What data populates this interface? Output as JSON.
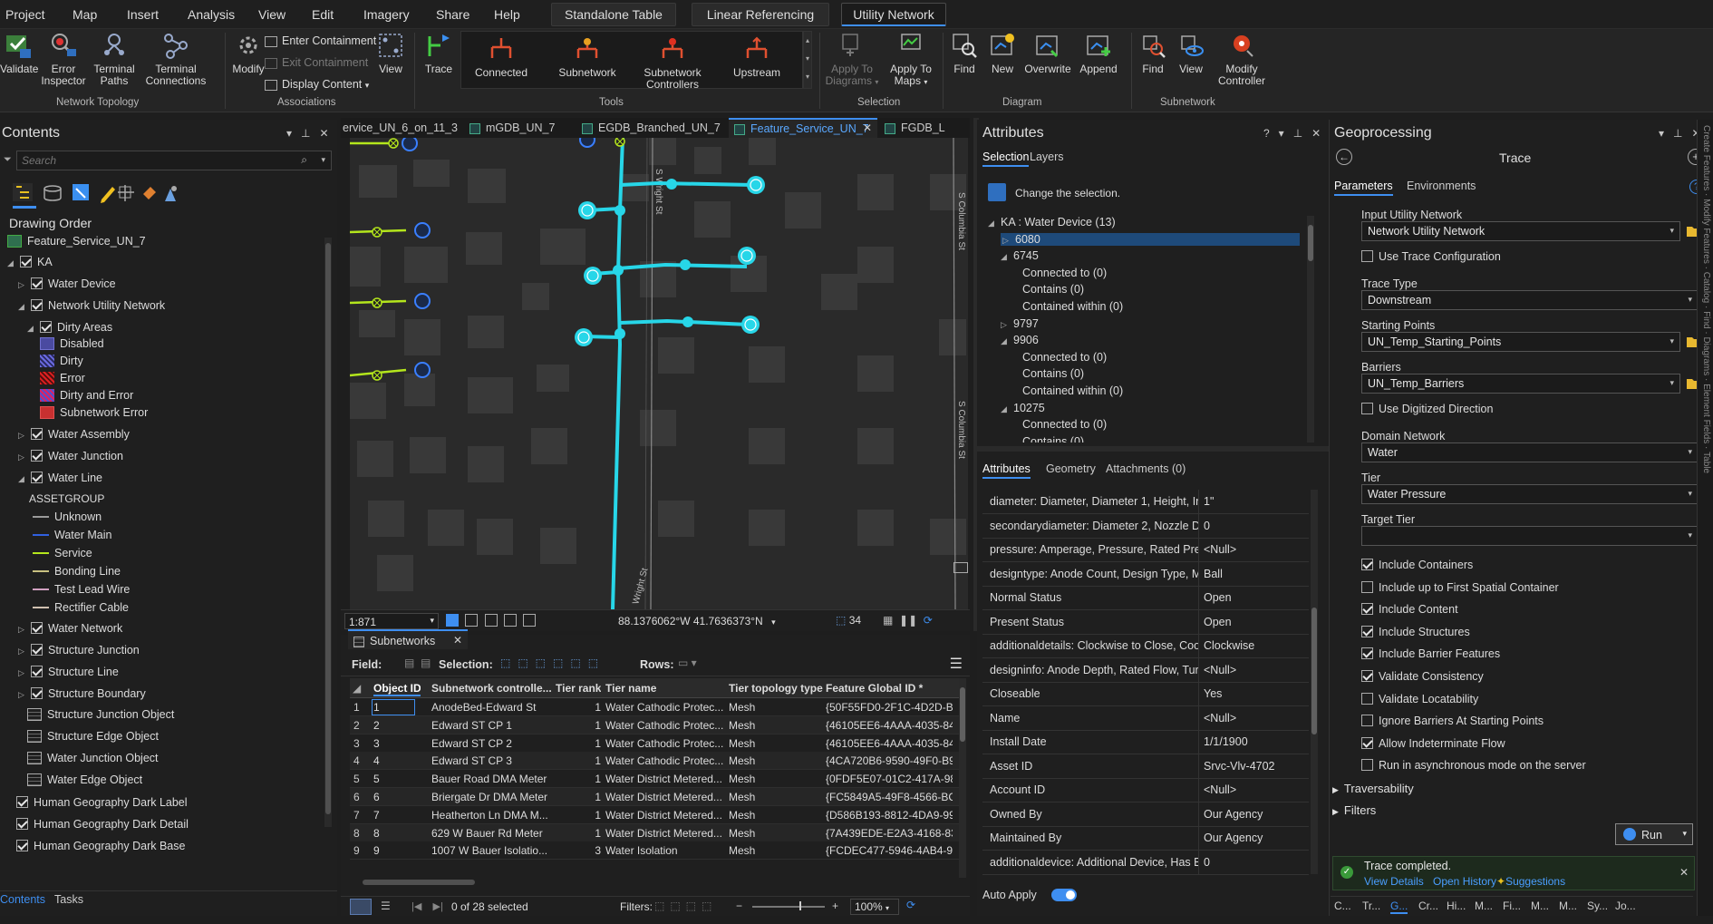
{
  "menubar": {
    "items": [
      "Project",
      "Map",
      "Insert",
      "Analysis",
      "View",
      "Edit",
      "Imagery",
      "Share",
      "Help"
    ],
    "context_tabs": [
      "Standalone Table",
      "Linear Referencing",
      "Utility Network"
    ]
  },
  "ribbon": {
    "network_topology": {
      "label": "Network Topology",
      "validate": "Validate",
      "error_inspector": "Error Inspector",
      "terminal_paths": "Terminal Paths",
      "terminal_connections": "Terminal Connections"
    },
    "associations": {
      "label": "Associations",
      "modify": "Modify",
      "enter_containment": "Enter Containment",
      "exit_containment": "Exit Containment",
      "display_content": "Display Content",
      "view": "View"
    },
    "tools": {
      "label": "Tools",
      "trace": "Trace",
      "connected": "Connected",
      "subnetwork": "Subnetwork",
      "subnetwork_controllers": "Subnetwork Controllers",
      "upstream": "Upstream"
    },
    "selection": {
      "label": "Selection",
      "apply_to_diagrams": "Apply To Diagrams",
      "apply_to_maps": "Apply To Maps"
    },
    "diagram": {
      "label": "Diagram",
      "find": "Find",
      "new": "New",
      "overwrite": "Overwrite",
      "append": "Append"
    },
    "subnetwork": {
      "label": "Subnetwork",
      "find": "Find",
      "view": "View",
      "modify_controller": "Modify Controller"
    }
  },
  "contents": {
    "title": "Contents",
    "search_placeholder": "Search",
    "drawing_order": "Drawing Order",
    "map_name": "Feature_Service_UN_7",
    "ka": "KA",
    "water_device": "Water Device",
    "network_utility_network": "Network Utility Network",
    "dirty_areas": "Dirty Areas",
    "dirty_legend": [
      "Disabled",
      "Dirty",
      "Error",
      "Dirty and Error",
      "Subnetwork Error"
    ],
    "water_assembly": "Water Assembly",
    "water_junction": "Water Junction",
    "water_line": "Water Line",
    "assetgroup": "ASSETGROUP",
    "line_legend": [
      "Unknown",
      "Water Main",
      "Service",
      "Bonding Line",
      "Test Lead Wire",
      "Rectifier Cable"
    ],
    "water_network": "Water Network",
    "structure_junction": "Structure Junction",
    "structure_line": "Structure Line",
    "structure_boundary": "Structure Boundary",
    "objects": [
      "Structure Junction Object",
      "Structure Edge Object",
      "Water Junction Object",
      "Water Edge Object"
    ],
    "basemaps": [
      "Human Geography Dark Label",
      "Human Geography Dark Detail",
      "Human Geography Dark Base"
    ],
    "bottom_tabs": [
      "Contents",
      "Tasks"
    ]
  },
  "map_tabs": [
    "ervice_UN_6_on_11_3",
    "mGDB_UN_7",
    "EGDB_Branched_UN_7",
    "Feature_Service_UN_7",
    "FGDB_L"
  ],
  "map": {
    "scale": "1:871",
    "coords": "88.1376062°W 41.7636373°N",
    "selected_count": "34",
    "streets": [
      "S Wright St",
      "S Columbia St",
      "S Columbia St",
      "Wright St"
    ]
  },
  "table": {
    "tab": "Subnetworks",
    "field_label": "Field:",
    "selection_label": "Selection:",
    "rows_label": "Rows:",
    "columns": [
      "Object ID *",
      "Subnetwork controlle...",
      "Tier rank",
      "Tier name",
      "Tier topology type",
      "Feature Global ID *"
    ],
    "rows": [
      [
        "1",
        "AnodeBed-Edward St",
        "1",
        "Water Cathodic Protec...",
        "Mesh",
        "{50F55FD0-2F1C-4D2D-BD("
      ],
      [
        "2",
        "Edward ST CP 1",
        "1",
        "Water Cathodic Protec...",
        "Mesh",
        "{46105EE6-4AAA-4035-843("
      ],
      [
        "3",
        "Edward ST CP 2",
        "1",
        "Water Cathodic Protec...",
        "Mesh",
        "{46105EE6-4AAA-4035-843("
      ],
      [
        "4",
        "Edward ST CP 3",
        "1",
        "Water Cathodic Protec...",
        "Mesh",
        "{4CA720B6-9590-49F0-B9B5"
      ],
      [
        "5",
        "Bauer Road DMA Meter",
        "1",
        "Water District Metered...",
        "Mesh",
        "{0FDF5E07-01C2-417A-989("
      ],
      [
        "6",
        "Briergate Dr DMA Meter",
        "1",
        "Water District Metered...",
        "Mesh",
        "{FC5849A5-49F8-4566-BC9E"
      ],
      [
        "7",
        "Heatherton Ln DMA M...",
        "1",
        "Water District Metered...",
        "Mesh",
        "{D586B193-8812-4DA9-99F-"
      ],
      [
        "8",
        "629 W Bauer Rd Meter",
        "1",
        "Water District Metered...",
        "Mesh",
        "{7A439EDE-E2A3-4168-838I"
      ],
      [
        "9",
        "1007 W Bauer Isolatio...",
        "3",
        "Water Isolation",
        "Mesh",
        "{FCDEC477-5946-4AB4-9EB"
      ]
    ],
    "selected_status": "0 of 28 selected",
    "filters_label": "Filters:",
    "zoom": "100%"
  },
  "attributes": {
    "title": "Attributes",
    "tabs": [
      "Selection",
      "Layers"
    ],
    "change_selection": "Change the selection.",
    "tree": [
      "KA : Water Device (13)",
      "6080",
      "6745",
      "Connected to (0)",
      "Contains (0)",
      "Contained within (0)",
      "9797",
      "9906",
      "Connected to (0)",
      "Contains (0)",
      "Contained within (0)",
      "10275",
      "Connected to (0)",
      "Contains (0)"
    ],
    "lower_tabs": [
      "Attributes",
      "Geometry",
      "Attachments (0)"
    ],
    "rows": [
      [
        "diameter: Diameter, Diameter 1, Height, Inle",
        "1\""
      ],
      [
        "secondarydiameter: Diameter 2, Nozzle Diar",
        "0"
      ],
      [
        "pressure: Amperage, Pressure, Rated Pressu",
        "<Null>"
      ],
      [
        "designtype: Anode Count, Design Type, Ma",
        "Ball"
      ],
      [
        "Normal Status",
        "Open"
      ],
      [
        "Present Status",
        "Open"
      ],
      [
        "additionaldetails: Clockwise to Close, Coolir",
        "Clockwise"
      ],
      [
        "designinfo: Anode Depth, Rated Flow, Turn:",
        "<Null>"
      ],
      [
        "Closeable",
        "Yes"
      ],
      [
        "Name",
        "<Null>"
      ],
      [
        "Install Date",
        "1/1/1900"
      ],
      [
        "Asset ID",
        "Srvc-Vlv-4702"
      ],
      [
        "Account ID",
        "<Null>"
      ],
      [
        "Owned By",
        "Our Agency"
      ],
      [
        "Maintained By",
        "Our Agency"
      ],
      [
        "additionaldevice: Additional Device, Has By",
        "0"
      ]
    ],
    "auto_apply": "Auto Apply"
  },
  "geoprocessing": {
    "title": "Geoprocessing",
    "tool": "Trace",
    "tabs": [
      "Parameters",
      "Environments"
    ],
    "input_utility_network_label": "Input Utility Network",
    "input_utility_network": "Network Utility Network",
    "use_trace_configuration": "Use Trace Configuration",
    "trace_type_label": "Trace Type",
    "trace_type": "Downstream",
    "starting_points_label": "Starting Points",
    "starting_points": "UN_Temp_Starting_Points",
    "barriers_label": "Barriers",
    "barriers": "UN_Temp_Barriers",
    "use_digitized_direction": "Use Digitized Direction",
    "domain_network_label": "Domain Network",
    "domain_network": "Water",
    "tier_label": "Tier",
    "tier": "Water Pressure",
    "target_tier_label": "Target Tier",
    "target_tier": "",
    "checks": [
      {
        "label": "Include Containers",
        "checked": true
      },
      {
        "label": "Include up to First Spatial Container",
        "checked": false
      },
      {
        "label": "Include Content",
        "checked": true
      },
      {
        "label": "Include Structures",
        "checked": true
      },
      {
        "label": "Include Barrier Features",
        "checked": true
      },
      {
        "label": "Validate Consistency",
        "checked": true
      },
      {
        "label": "Validate Locatability",
        "checked": false
      },
      {
        "label": "Ignore Barriers At Starting Points",
        "checked": false
      },
      {
        "label": "Allow Indeterminate Flow",
        "checked": true
      },
      {
        "label": "Run in asynchronous mode on the server",
        "checked": false
      }
    ],
    "traversability": "Traversability",
    "filters": "Filters",
    "run": "Run",
    "status": "Trace completed.",
    "view_details": "View Details",
    "open_history": "Open History",
    "suggestions": "Suggestions",
    "bottom_tabs": [
      "C...",
      "Tr...",
      "G...",
      "Cr...",
      "Hi...",
      "M...",
      "Fi...",
      "M...",
      "M...",
      "Sy...",
      "Jo..."
    ]
  },
  "side_strip": [
    "Create Features",
    "Modify Features",
    "Catalog",
    "Find",
    "Diagrams",
    "Element Fields",
    "Table"
  ],
  "colors": {
    "accent": "#3e8ef0",
    "network": "#27d6e8",
    "service": "#b4e61c",
    "panel": "#1f1f1f"
  }
}
